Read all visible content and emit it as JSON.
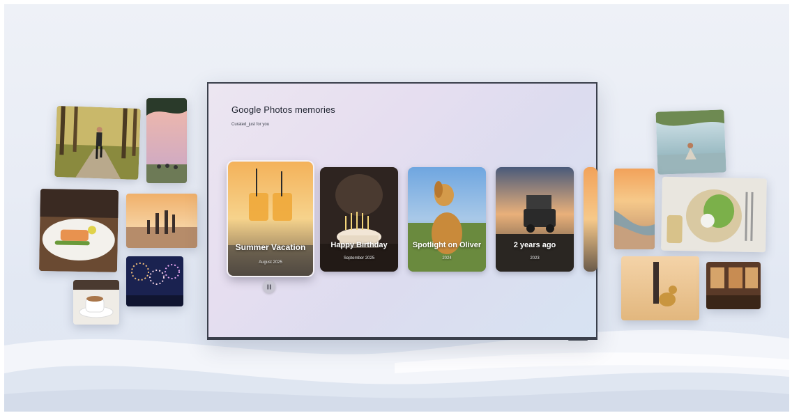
{
  "screen": {
    "title": "Google Photos memories",
    "subtitle": "Curated_just for you"
  },
  "memories": [
    {
      "title": "Summer Vacation",
      "date": "August 2025",
      "focused": true
    },
    {
      "title": "Happy Birthday",
      "date": "September 2025"
    },
    {
      "title": "Spotlight on Oliver",
      "date": "2024"
    },
    {
      "title": "2 years ago",
      "date": "2023"
    }
  ],
  "controls": {
    "pause_icon": "pause-icon"
  },
  "colors": {
    "tv_bezel": "#3a3f4b",
    "background": "#e8ecf5"
  }
}
